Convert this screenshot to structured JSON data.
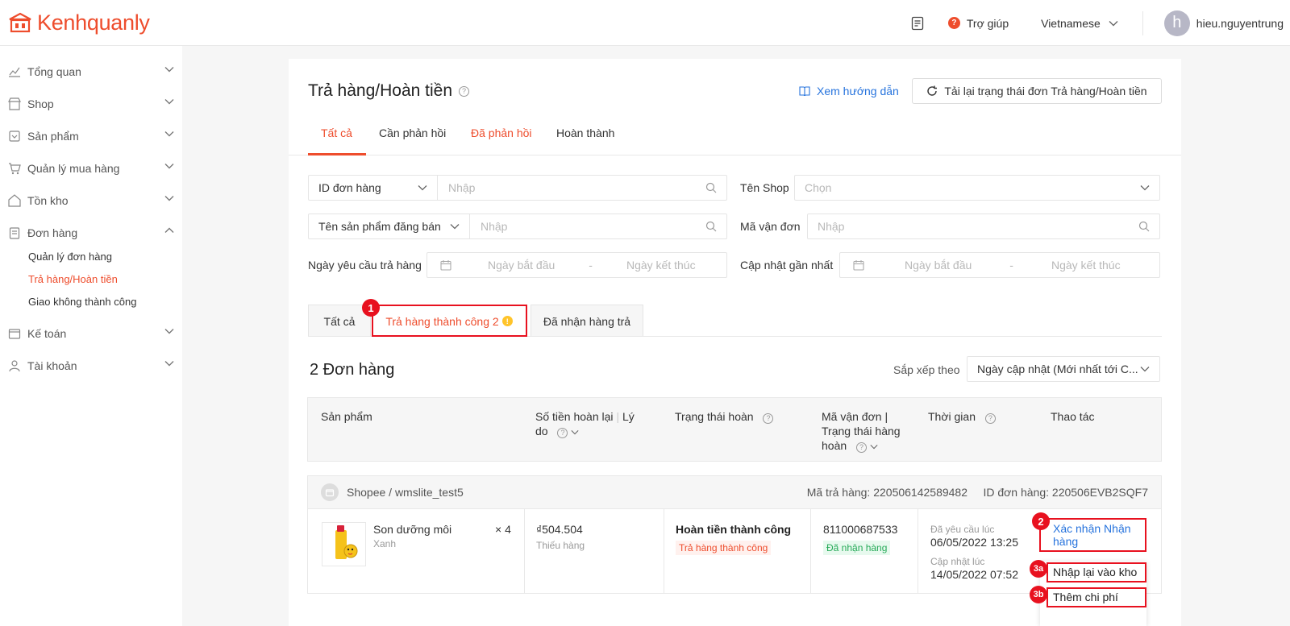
{
  "header": {
    "brand": "Kenhquanly",
    "help_label": "Trợ giúp",
    "help_icon_glyph": "?",
    "language": "Vietnamese",
    "username": "hieu.nguyentrung",
    "avatar_initial": "h",
    "brand_color": "#ee4d2d"
  },
  "sidebar": {
    "items": [
      {
        "label": "Tổng quan",
        "icon": "chart-icon"
      },
      {
        "label": "Shop",
        "icon": "shop-icon"
      },
      {
        "label": "Sản phẩm",
        "icon": "product-icon"
      },
      {
        "label": "Quản lý mua hàng",
        "icon": "cart-icon"
      },
      {
        "label": "Tồn kho",
        "icon": "warehouse-icon"
      },
      {
        "label": "Đơn hàng",
        "icon": "order-icon"
      },
      {
        "label": "Kế toán",
        "icon": "accounting-icon"
      },
      {
        "label": "Tài khoản",
        "icon": "account-icon"
      }
    ],
    "subitems": [
      {
        "label": "Quản lý đơn hàng"
      },
      {
        "label": "Trả hàng/Hoàn tiền"
      },
      {
        "label": "Giao không thành công"
      }
    ]
  },
  "page": {
    "title": "Trả hàng/Hoàn tiền",
    "guide_link": "Xem hướng dẫn",
    "reload_button": "Tải lại trạng thái đơn Trả hàng/Hoàn tiền",
    "tabs": [
      "Tất cả",
      "Cần phản hồi",
      "Đã phản hồi",
      "Hoàn thành"
    ]
  },
  "filters": {
    "order_id_select": "ID đơn hàng",
    "order_id_placeholder": "Nhập",
    "shop_label": "Tên Shop",
    "shop_placeholder": "Chọn",
    "product_select": "Tên sản phẩm đăng bán",
    "product_placeholder": "Nhập",
    "tracking_label": "Mã vận đơn",
    "tracking_placeholder": "Nhập",
    "request_date_label": "Ngày yêu cầu trả hàng",
    "updated_label": "Cập nhật gần nhất",
    "start_date": "Ngày bắt đầu",
    "end_date": "Ngày kết thúc",
    "date_sep": "-"
  },
  "subtabs": {
    "all": "Tất cả",
    "success": "Trả hàng thành công 2",
    "success_warn": "!",
    "received": "Đã nhận hàng trả"
  },
  "list": {
    "count_title": "2 Đơn hàng",
    "sort_label": "Sắp xếp theo",
    "sort_value": "Ngày cập nhật (Mới nhất tới C...",
    "columns": {
      "product": "Sản phẩm",
      "refund_line1": "Số tiền hoàn lại",
      "refund_sep": "|",
      "refund_line1b": "Lý",
      "refund_line2": "do",
      "status": "Trạng thái hoàn",
      "tracking_line1": "Mã vận đơn |",
      "tracking_line2": "Trạng thái hàng",
      "tracking_line3": "hoàn",
      "time": "Thời gian",
      "action": "Thao tác"
    }
  },
  "order": {
    "shop": "Shopee / wmslite_test5",
    "return_code": "Mã trả hàng: 220506142589482",
    "order_id": "ID đơn hàng: 220506EVB2SQF7",
    "product_name": "Son dưỡng môi",
    "variant": "Xanh",
    "quantity": "× 4",
    "amount": "₫504.504",
    "reason": "Thiếu hàng",
    "status": "Hoàn tiền thành công",
    "status_tag": "Trả hàng thành công",
    "tracking": "811000687533",
    "tracking_tag": "Đã nhận hàng",
    "requested_label": "Đã yêu cầu lúc",
    "requested_at": "06/05/2022 13:25",
    "updated_label": "Cập nhật lúc",
    "updated_at": "14/05/2022 07:52",
    "action_confirm": "Xác nhận Nhận hàng",
    "action_restock": "Nhập lại vào kho",
    "action_cost": "Thêm chi phí"
  },
  "annotations": {
    "b1": "1",
    "b2": "2",
    "b3a": "3a",
    "b3b": "3b",
    "color": "#e8111f"
  }
}
